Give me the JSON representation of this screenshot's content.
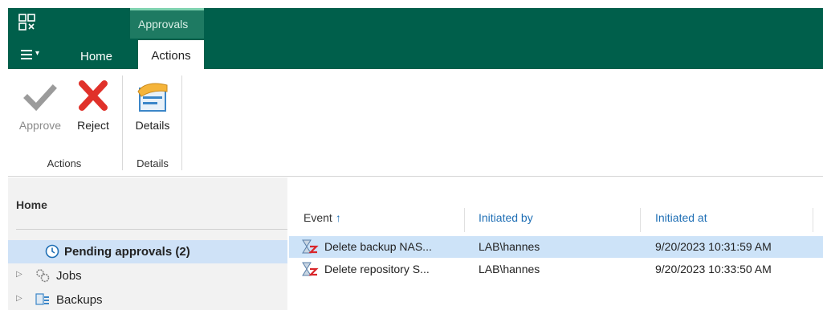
{
  "titlebar": {
    "app_icon": "veeam-logo-icon",
    "context_tab": "Approvals",
    "menu_icon": "hamburger-menu-icon",
    "tabs": [
      {
        "label": "Home",
        "active": false
      },
      {
        "label": "Actions",
        "active": true
      }
    ],
    "accent_color": "#005f4b"
  },
  "ribbon": {
    "groups": [
      {
        "label": "Actions",
        "buttons": [
          {
            "label": "Approve",
            "icon": "checkmark-icon",
            "enabled": false
          },
          {
            "label": "Reject",
            "icon": "red-x-icon",
            "enabled": true
          }
        ]
      },
      {
        "label": "Details",
        "buttons": [
          {
            "label": "Details",
            "icon": "details-hand-icon",
            "enabled": true
          }
        ]
      }
    ]
  },
  "nav": {
    "title": "Home",
    "items": [
      {
        "label": "Pending approvals (2)",
        "icon": "clock-icon",
        "selected": true
      },
      {
        "label": "Jobs",
        "icon": "gears-icon",
        "selected": false
      },
      {
        "label": "Backups",
        "icon": "backups-icon",
        "selected": false
      }
    ]
  },
  "grid": {
    "columns": [
      "Event",
      "Initiated by",
      "Initiated at"
    ],
    "sort_indicator": "↑",
    "rows": [
      {
        "event": "Delete backup NAS...",
        "initiated_by": "LAB\\hannes",
        "initiated_at": "9/20/2023 10:31:59 AM",
        "icon": "hourglass-z-icon",
        "selected": true
      },
      {
        "event": "Delete repository S...",
        "initiated_by": "LAB\\hannes",
        "initiated_at": "9/20/2023 10:33:50 AM",
        "icon": "hourglass-z-icon",
        "selected": false
      }
    ]
  }
}
